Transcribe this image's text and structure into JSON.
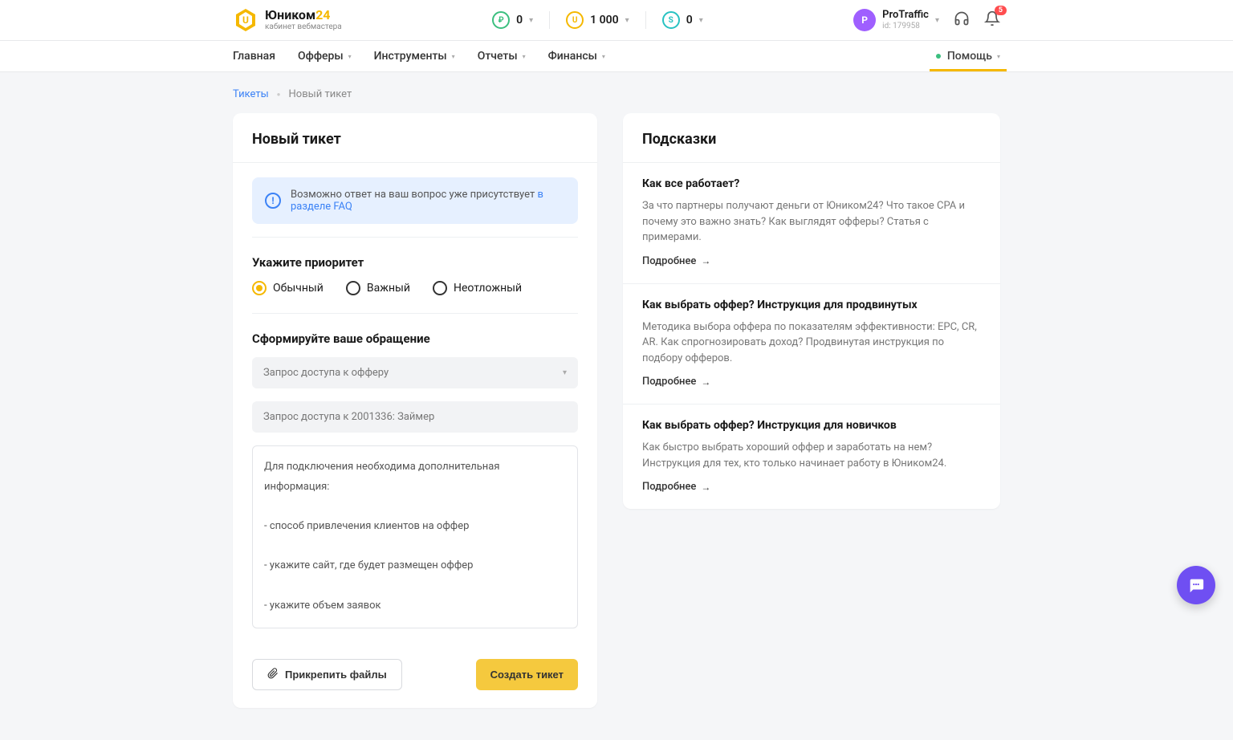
{
  "logo": {
    "title_a": "Юником",
    "title_b": "24",
    "sub": "кабинет вебмастера"
  },
  "balances": {
    "rub": "0",
    "points": "1 000",
    "bonus": "0"
  },
  "user": {
    "initial": "P",
    "name": "ProTraffic",
    "id": "id: 179958"
  },
  "notifications": {
    "count": "5"
  },
  "nav": {
    "home": "Главная",
    "offers": "Офферы",
    "tools": "Инструменты",
    "reports": "Отчеты",
    "finance": "Финансы",
    "help": "Помощь"
  },
  "breadcrumb": {
    "tickets": "Тикеты",
    "current": "Новый тикет"
  },
  "ticket": {
    "heading": "Новый тикет",
    "alert_text": "Возможно ответ на ваш вопрос уже присутствует ",
    "alert_link": "в разделе FAQ",
    "priority_label": "Укажите приоритет",
    "priority": {
      "normal": "Обычный",
      "important": "Важный",
      "urgent": "Неотложный"
    },
    "form_label": "Сформируйте ваше обращение",
    "request_type": "Запрос доступа к офферу",
    "subject": "Запрос доступа к 2001336: Займер",
    "body_line1": "Для подключения необходима дополнительная информация:",
    "body_line2": "- способ привлечения клиентов на оффер",
    "body_line3": "- укажите сайт, где будет размещен оффер",
    "body_line4": "- укажите объем заявок",
    "attach": "Прикрепить файлы",
    "submit": "Создать тикет"
  },
  "hints": {
    "heading": "Подсказки",
    "more": "Подробнее",
    "items": [
      {
        "title": "Как все работает?",
        "text": "За что партнеры получают деньги от Юником24? Что такое CPA и почему это важно знать? Как выглядят офферы? Статья с примерами."
      },
      {
        "title": "Как выбрать оффер? Инструкция для продвинутых",
        "text": "Методика выбора оффера по показателям эффективности: EPC, CR, AR. Как спрогнозировать доход? Продвинутая инструкция по подбору офферов."
      },
      {
        "title": "Как выбрать оффер? Инструкция для новичков",
        "text": "Как быстро выбрать хороший оффер и заработать на нем? Инструкция для тех, кто только начинает работу в Юником24."
      }
    ]
  }
}
